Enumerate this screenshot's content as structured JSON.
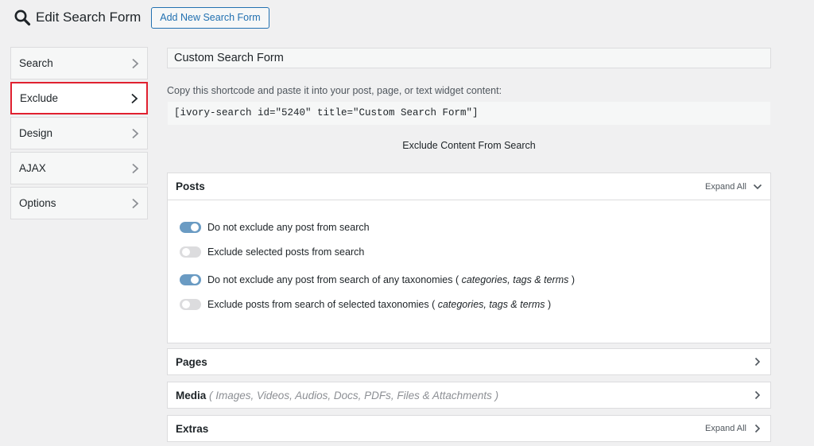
{
  "header": {
    "title": "Edit Search Form",
    "add_button": "Add New Search Form"
  },
  "sidebar": {
    "items": [
      {
        "label": "Search"
      },
      {
        "label": "Exclude"
      },
      {
        "label": "Design"
      },
      {
        "label": "AJAX"
      },
      {
        "label": "Options"
      }
    ],
    "active": "Exclude"
  },
  "form": {
    "name_value": "Custom Search Form",
    "copy_instructions": "Copy this shortcode and paste it into your post, page, or text widget content:",
    "shortcode": "[ivory-search id=\"5240\" title=\"Custom Search Form\"]",
    "section_heading": "Exclude Content From Search"
  },
  "posts": {
    "title": "Posts",
    "expand_all": "Expand All",
    "options": [
      {
        "label": "Do not exclude any post from search",
        "on": true
      },
      {
        "label": "Exclude selected posts from search",
        "on": false
      },
      {
        "label": "Do not exclude any post from search of any taxonomies ( ",
        "italic": "categories, tags & terms",
        "suffix": " )",
        "on": true
      },
      {
        "label": "Exclude posts from search of selected taxonomies ( ",
        "italic": "categories, tags & terms",
        "suffix": " )",
        "on": false
      }
    ]
  },
  "pages": {
    "title": "Pages"
  },
  "media": {
    "title": "Media",
    "subtitle": " ( Images, Videos, Audios, Docs, PDFs, Files & Attachments )"
  },
  "extras": {
    "title": "Extras",
    "expand_all": "Expand All"
  },
  "colors": {
    "accent": "#2271b1",
    "active_border": "#e0202f",
    "toggle_on": "#6a9bc3",
    "toggle_off": "#dcdcde"
  }
}
